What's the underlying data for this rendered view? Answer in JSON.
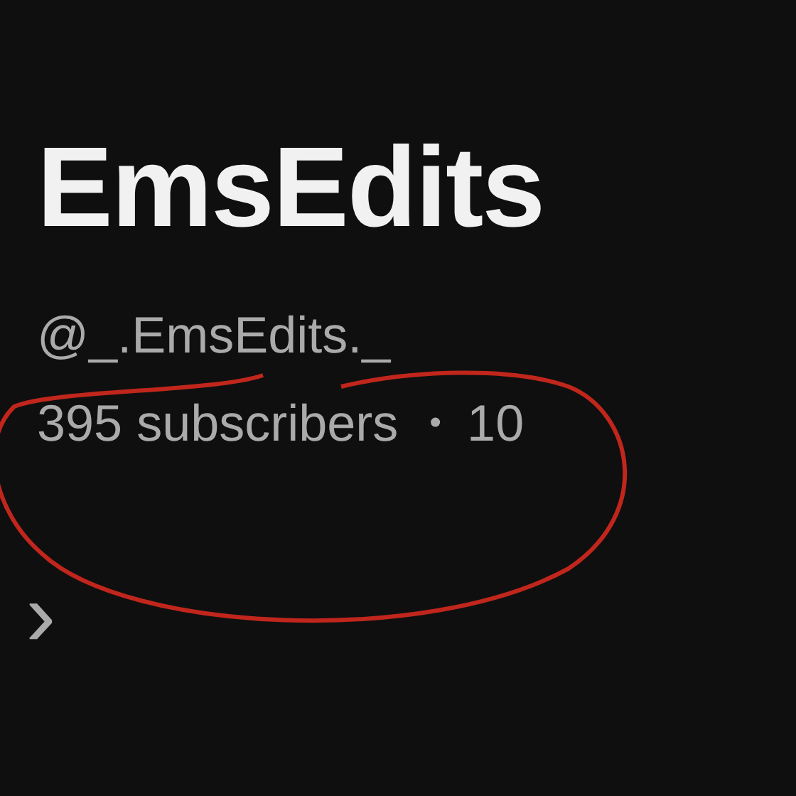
{
  "channel": {
    "name": "EmsEdits",
    "handle": "@_.EmsEdits._",
    "subscribers": "395 subscribers",
    "separator": "•",
    "videos": "10"
  },
  "more_arrow": {
    "symbol": "›"
  }
}
